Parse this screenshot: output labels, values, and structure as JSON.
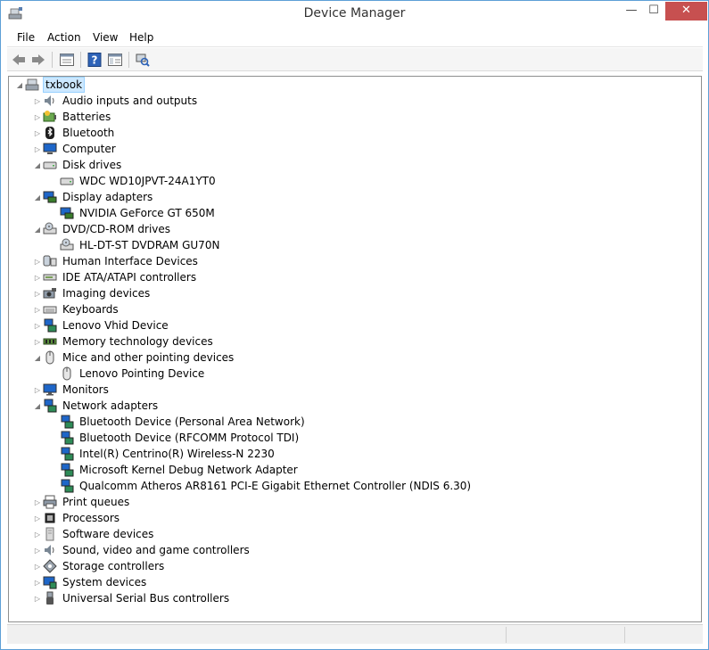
{
  "window": {
    "title": "Device Manager"
  },
  "titlebar": {
    "minimize": "—",
    "maximize": "☐",
    "close": "✕"
  },
  "menu": [
    "File",
    "Action",
    "View",
    "Help"
  ],
  "toolbar": {
    "icons": [
      "back-arrow-icon",
      "forward-arrow-icon",
      "properties-icon",
      "help-icon",
      "show-hide-console-icon",
      "scan-hardware-icon"
    ]
  },
  "tree": {
    "root": "txbook",
    "categories": [
      {
        "label": "Audio inputs and outputs",
        "icon": "speaker-icon",
        "expanded": false,
        "children": []
      },
      {
        "label": "Batteries",
        "icon": "battery-icon",
        "expanded": false,
        "children": []
      },
      {
        "label": "Bluetooth",
        "icon": "bluetooth-icon",
        "expanded": false,
        "children": []
      },
      {
        "label": "Computer",
        "icon": "computer-icon",
        "expanded": false,
        "children": []
      },
      {
        "label": "Disk drives",
        "icon": "disk-drive-icon",
        "expanded": true,
        "children": [
          "WDC WD10JPVT-24A1YT0"
        ]
      },
      {
        "label": "Display adapters",
        "icon": "display-adapter-icon",
        "expanded": true,
        "children": [
          "NVIDIA GeForce GT 650M"
        ]
      },
      {
        "label": "DVD/CD-ROM drives",
        "icon": "dvd-drive-icon",
        "expanded": true,
        "children": [
          "HL-DT-ST DVDRAM GU70N"
        ]
      },
      {
        "label": "Human Interface Devices",
        "icon": "hid-icon",
        "expanded": false,
        "children": []
      },
      {
        "label": "IDE ATA/ATAPI controllers",
        "icon": "ide-controller-icon",
        "expanded": false,
        "children": []
      },
      {
        "label": "Imaging devices",
        "icon": "camera-icon",
        "expanded": false,
        "children": []
      },
      {
        "label": "Keyboards",
        "icon": "keyboard-icon",
        "expanded": false,
        "children": []
      },
      {
        "label": "Lenovo Vhid Device",
        "icon": "network-device-icon",
        "expanded": false,
        "children": []
      },
      {
        "label": "Memory technology devices",
        "icon": "memory-icon",
        "expanded": false,
        "children": []
      },
      {
        "label": "Mice and other pointing devices",
        "icon": "mouse-icon",
        "expanded": true,
        "children": [
          "Lenovo Pointing Device"
        ]
      },
      {
        "label": "Monitors",
        "icon": "monitor-icon",
        "expanded": false,
        "children": []
      },
      {
        "label": "Network adapters",
        "icon": "network-adapter-icon",
        "expanded": true,
        "children": [
          "Bluetooth Device (Personal Area Network)",
          "Bluetooth Device (RFCOMM Protocol TDI)",
          "Intel(R) Centrino(R) Wireless-N 2230",
          "Microsoft Kernel Debug Network Adapter",
          "Qualcomm Atheros AR8161 PCI-E Gigabit Ethernet Controller (NDIS 6.30)"
        ]
      },
      {
        "label": "Print queues",
        "icon": "printer-icon",
        "expanded": false,
        "children": []
      },
      {
        "label": "Processors",
        "icon": "processor-icon",
        "expanded": false,
        "children": []
      },
      {
        "label": "Software devices",
        "icon": "software-device-icon",
        "expanded": false,
        "children": []
      },
      {
        "label": "Sound, video and game controllers",
        "icon": "sound-icon",
        "expanded": false,
        "children": []
      },
      {
        "label": "Storage controllers",
        "icon": "storage-controller-icon",
        "expanded": false,
        "children": []
      },
      {
        "label": "System devices",
        "icon": "system-device-icon",
        "expanded": false,
        "children": []
      },
      {
        "label": "Universal Serial Bus controllers",
        "icon": "usb-icon",
        "expanded": false,
        "children": []
      }
    ]
  },
  "colors": {
    "selection_bg": "#cce8ff",
    "selection_border": "#99d1ff",
    "close_button": "#c75050",
    "window_border": "#5d9fd6"
  }
}
